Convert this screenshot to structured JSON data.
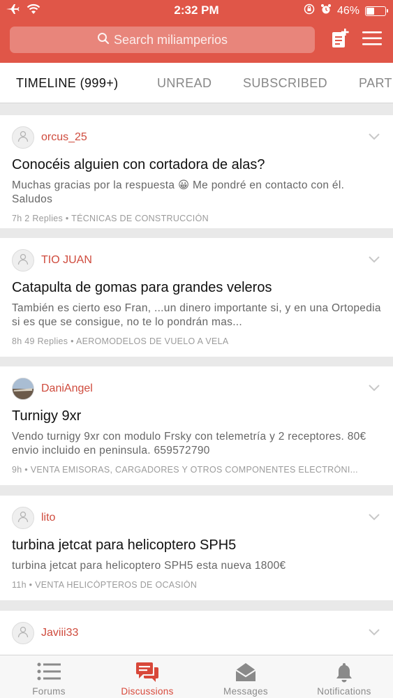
{
  "status_bar": {
    "time": "2:32 PM",
    "battery": "46%",
    "battery_level": 0.46
  },
  "header": {
    "search_placeholder": "Search miliamperios"
  },
  "tabs": [
    {
      "label": "TIMELINE (999+)",
      "active": true
    },
    {
      "label": "UNREAD",
      "active": false
    },
    {
      "label": "SUBSCRIBED",
      "active": false
    },
    {
      "label": "PART",
      "active": false
    }
  ],
  "posts": [
    {
      "user": "orcus_25",
      "title": "Conocéis alguien con cortadora de alas?",
      "excerpt": "Muchas gracias por la respuesta 😀  Me pondré en contacto con él. Saludos",
      "time": "7h",
      "replies": "2 Replies",
      "forum": "TÉCNICAS DE CONSTRUCCIÓN"
    },
    {
      "user": "TIO JUAN",
      "title": "Catapulta de gomas para grandes veleros",
      "excerpt": "También es cierto eso Fran,  ...un dinero importante si, y en una Ortopedia si es que se consigue,  no te lo pondrán mas...",
      "time": "8h",
      "replies": "49 Replies",
      "forum": "AEROMODELOS DE VUELO A VELA"
    },
    {
      "user": "DaniAngel",
      "title": "Turnigy 9xr",
      "excerpt": "Vendo turnigy 9xr con modulo Frsky con telemetría y 2 receptores. 80€  envio incluido en peninsula. 659572790",
      "time": "9h",
      "replies": "",
      "forum": "VENTA EMISORAS, CARGADORES Y OTROS COMPONENTES ELECTRÓNI..."
    },
    {
      "user": "lito",
      "title": "turbina jetcat para helicoptero SPH5",
      "excerpt": "turbina jetcat para helicoptero SPH5 esta nueva 1800€",
      "time": "11h",
      "replies": "",
      "forum": "VENTA HELICÓPTEROS DE OCASIÓN"
    },
    {
      "user": "Javiii33",
      "title": "",
      "excerpt": "",
      "time": "",
      "replies": "",
      "forum": ""
    }
  ],
  "meta_separator": "•",
  "bottom_nav": [
    {
      "label": "Forums",
      "icon": "list-icon",
      "active": false
    },
    {
      "label": "Discussions",
      "icon": "chat-bubbles-icon",
      "active": true
    },
    {
      "label": "Messages",
      "icon": "envelope-icon",
      "active": false
    },
    {
      "label": "Notifications",
      "icon": "bell-icon",
      "active": false
    }
  ],
  "colors": {
    "brand": "#e05648",
    "username": "#cf4b3d",
    "active_nav": "#d8483a"
  }
}
